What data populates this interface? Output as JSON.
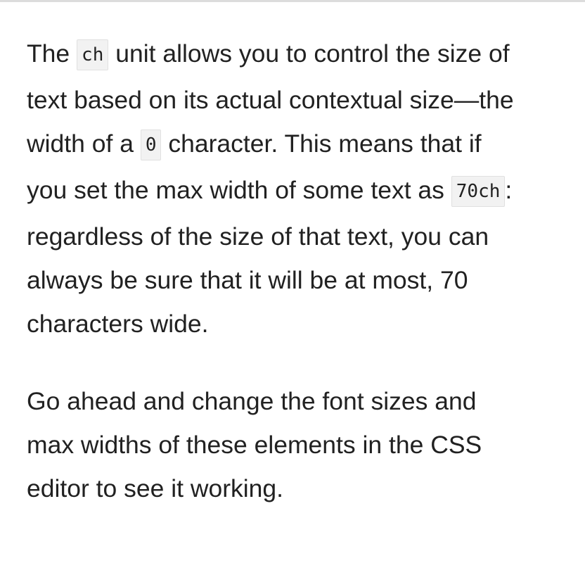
{
  "article": {
    "paragraph1": {
      "t1": "The ",
      "code1": "ch",
      "t2": " unit allows you to control the size of text based on its actual contextual size—the width of a ",
      "code2": "0",
      "t3": " character. This means that if you set the max width of some text as ",
      "code3": "70ch",
      "t4": ": regardless of the size of that text, you can always be sure that it will be at most, 70 characters wide."
    },
    "paragraph2": {
      "text": "Go ahead and change the font sizes and max widths of these elements in the CSS editor to see it working."
    }
  },
  "colors": {
    "text": "#212121",
    "code_background": "#f2f2f2",
    "top_border": "#dcdcdc"
  }
}
